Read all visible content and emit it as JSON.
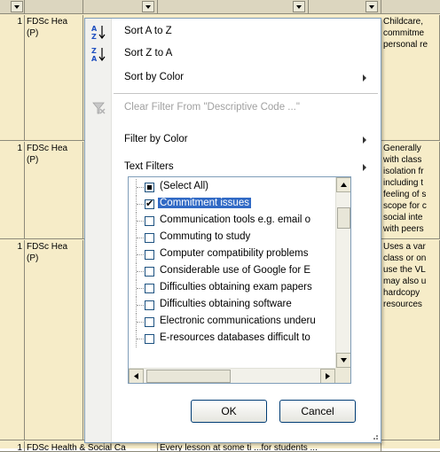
{
  "sheet": {
    "rows": [
      {
        "num": "1",
        "code": "FDSc Hea (P)",
        "desc": "Childcare, commitme personal re"
      },
      {
        "num": "1",
        "code": "FDSc Hea (P)",
        "desc": "Generally with class isolation fr including t feeling of s scope for c social inte with peers"
      },
      {
        "num": "1",
        "code": "FDSc Hea (P)",
        "desc": "Uses a var class or on use the VL may also u hardcopy resources"
      },
      {
        "num": "1",
        "code": "FDSc Health & Social Ca",
        "desc": "Every lesson at some ti ...for students ..."
      }
    ]
  },
  "menu": {
    "sort_az": "Sort A to Z",
    "sort_za": "Sort Z to A",
    "sort_by_color": "Sort by Color",
    "clear_filter": "Clear Filter From \"Descriptive Code ...\"",
    "filter_by_color": "Filter by Color",
    "text_filters": "Text Filters"
  },
  "list_items": [
    {
      "label": "(Select All)",
      "state": "mixed",
      "selected": false
    },
    {
      "label": "Commitment issues",
      "state": "checked",
      "selected": true
    },
    {
      "label": "Communication tools e.g. email o",
      "state": "unchecked",
      "selected": false
    },
    {
      "label": "Commuting to study",
      "state": "unchecked",
      "selected": false
    },
    {
      "label": "Computer compatibility problems",
      "state": "unchecked",
      "selected": false
    },
    {
      "label": "Considerable use of Google for E",
      "state": "unchecked",
      "selected": false
    },
    {
      "label": "Difficulties obtaining exam papers",
      "state": "unchecked",
      "selected": false
    },
    {
      "label": "Difficulties obtaining software",
      "state": "unchecked",
      "selected": false
    },
    {
      "label": "Electronic communications underu",
      "state": "unchecked",
      "selected": false
    },
    {
      "label": "E-resources databases difficult to",
      "state": "unchecked",
      "selected": false
    }
  ],
  "buttons": {
    "ok": "OK",
    "cancel": "Cancel"
  }
}
